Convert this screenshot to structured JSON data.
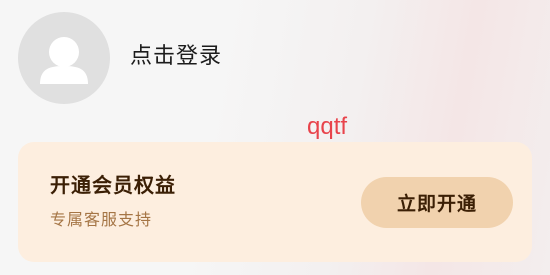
{
  "profile": {
    "avatar_icon": "default-user-avatar-icon",
    "login_label": "点击登录"
  },
  "watermark": "qqtf",
  "vip_card": {
    "title": "开通会员权益",
    "subtitle": "专属客服支持",
    "button_label": "立即开通"
  },
  "colors": {
    "card_background": "#fdeedf",
    "button_background": "#f1d2ae",
    "title_text": "#3b1f05",
    "subtitle_text": "#a57545",
    "watermark_text": "#e8434b",
    "avatar_background": "#e0e0e0"
  }
}
